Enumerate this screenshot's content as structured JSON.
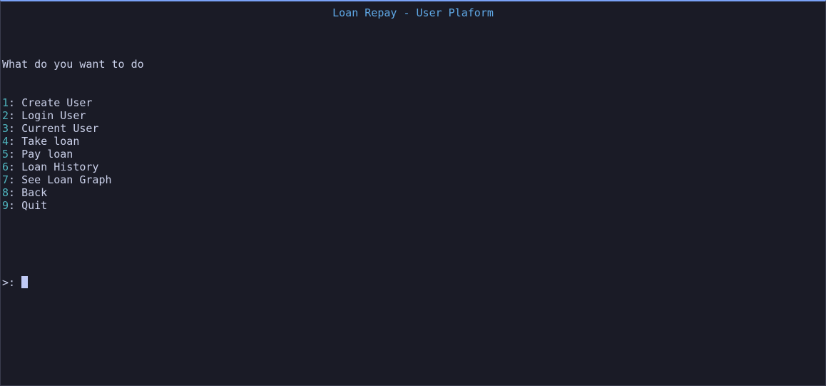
{
  "window": {
    "title": "Loan Repay - User Plaform"
  },
  "menu": {
    "prompt_heading": "What do you want to do",
    "items": [
      {
        "num": "1",
        "label": "Create User"
      },
      {
        "num": "2",
        "label": "Login User"
      },
      {
        "num": "3",
        "label": "Current User"
      },
      {
        "num": "4",
        "label": "Take loan"
      },
      {
        "num": "5",
        "label": "Pay loan"
      },
      {
        "num": "6",
        "label": "Loan History"
      },
      {
        "num": "7",
        "label": "See Loan Graph"
      },
      {
        "num": "8",
        "label": "Back"
      },
      {
        "num": "9",
        "label": "Quit"
      }
    ],
    "separator": ": ",
    "input_prompt": ">:",
    "input_value": ""
  },
  "colors": {
    "background": "#1a1b26",
    "title": "#5fa8e6",
    "number": "#4fb3bd",
    "text": "#c9cfe8",
    "accent_border": "#7aa2f7"
  }
}
